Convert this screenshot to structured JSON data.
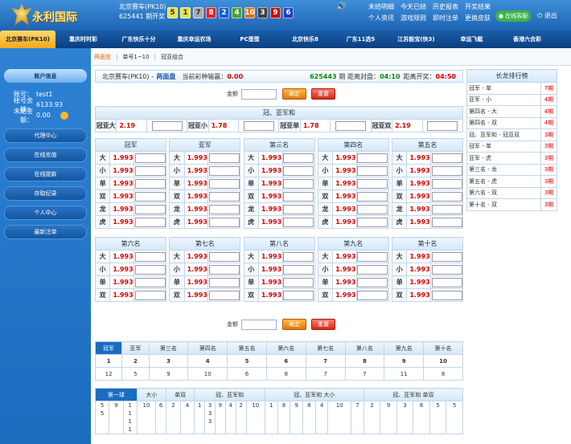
{
  "brand": {
    "name": "永利国际"
  },
  "lottery": {
    "name": "北京赛车(PK10)",
    "issue": "625441 期开奖",
    "balls": [
      {
        "n": "5",
        "c": "#e8e04a",
        "t": "#333"
      },
      {
        "n": "1",
        "c": "#e8e04a",
        "t": "#333"
      },
      {
        "n": "7",
        "c": "#aaaaaa",
        "t": "#333"
      },
      {
        "n": "8",
        "c": "#e0202a",
        "t": "#fff"
      },
      {
        "n": "2",
        "c": "#1060d0",
        "t": "#fff"
      },
      {
        "n": "4",
        "c": "#4aa030",
        "t": "#fff"
      },
      {
        "n": "10",
        "c": "#e07010",
        "t": "#fff"
      },
      {
        "n": "3",
        "c": "#404040",
        "t": "#fff"
      },
      {
        "n": "9",
        "c": "#c01010",
        "t": "#fff"
      },
      {
        "n": "6",
        "c": "#2040c0",
        "t": "#fff"
      }
    ]
  },
  "toplinks": [
    "未结明细",
    "今天已结",
    "历史报表",
    "开奖结果",
    "个人资讯",
    "游戏规则",
    "即时注单",
    "更换皮肤"
  ],
  "service": "在线客服",
  "logout": "退出",
  "nav": [
    "北京赛车(PK10)",
    "重庆时时彩",
    "广东快乐十分",
    "重庆幸运农场",
    "PC蛋蛋",
    "北京快乐8",
    "广东11选5",
    "江苏骰宝(快3)",
    "幸运飞艇",
    "香港六合彩"
  ],
  "side": {
    "title": "账户信息",
    "account_label": "账号：",
    "account": "test1",
    "balance_label": "帐号余额：",
    "balance": "6133.93",
    "unsettled_label": "未结金额：",
    "unsettled": "0.00",
    "menu": [
      "代理中心",
      "在线充值",
      "在线提款",
      "存取纪录",
      "个人中心",
      "最新注单"
    ]
  },
  "subnav": [
    "两面盘",
    "单号1~10",
    "冠亚组合"
  ],
  "info": {
    "game": "北京赛车(PK10)",
    "mode": "两面盘",
    "pl_label": "当前彩种输赢：",
    "pl": "0.00",
    "issue": "625443",
    "issue_suffix": "期 距离封盘：",
    "close": "04:10",
    "draw_label": "距离开奖：",
    "draw": "04:50"
  },
  "amount_label": "金额",
  "confirm": "确定",
  "reset": "重置",
  "gy": {
    "title": "冠、亚军和",
    "items": [
      {
        "l": "冠亚大",
        "o": "2.19"
      },
      {
        "l": "冠亚小",
        "o": "1.78"
      },
      {
        "l": "冠亚单",
        "o": "1.78"
      },
      {
        "l": "冠亚双",
        "o": "2.19"
      }
    ]
  },
  "odds": "1.993",
  "groups1": [
    {
      "t": "冠军",
      "rows": [
        "大",
        "小",
        "单",
        "双",
        "龙",
        "虎"
      ]
    },
    {
      "t": "亚军",
      "rows": [
        "大",
        "小",
        "单",
        "双",
        "龙",
        "虎"
      ]
    },
    {
      "t": "第三名",
      "rows": [
        "大",
        "小",
        "单",
        "双",
        "龙",
        "虎"
      ]
    },
    {
      "t": "第四名",
      "rows": [
        "大",
        "小",
        "单",
        "双",
        "龙",
        "虎"
      ]
    },
    {
      "t": "第五名",
      "rows": [
        "大",
        "小",
        "单",
        "双",
        "龙",
        "虎"
      ]
    }
  ],
  "groups2": [
    {
      "t": "第六名",
      "rows": [
        "大",
        "小",
        "单",
        "双"
      ]
    },
    {
      "t": "第七名",
      "rows": [
        "大",
        "小",
        "单",
        "双"
      ]
    },
    {
      "t": "第八名",
      "rows": [
        "大",
        "小",
        "单",
        "双"
      ]
    },
    {
      "t": "第九名",
      "rows": [
        "大",
        "小",
        "单",
        "双"
      ]
    },
    {
      "t": "第十名",
      "rows": [
        "大",
        "小",
        "单",
        "双"
      ]
    }
  ],
  "rank": {
    "title": "长龙排行榜",
    "rows": [
      [
        "冠军 - 单",
        "7期"
      ],
      [
        "亚军 - 小",
        "4期"
      ],
      [
        "第四名 - 大",
        "4期"
      ],
      [
        "第四名 - 双",
        "4期"
      ],
      [
        "冠、亚军和 - 冠亚双",
        "3期"
      ],
      [
        "冠军 - 单",
        "3期"
      ],
      [
        "亚军 - 虎",
        "3期"
      ],
      [
        "第三名 - 龙",
        "3期"
      ],
      [
        "第五名 - 虎",
        "3期"
      ],
      [
        "第六名 - 双",
        "3期"
      ],
      [
        "第十名 - 双",
        "3期"
      ]
    ]
  },
  "stats": {
    "tabs": [
      "冠军",
      "亚军",
      "第三名",
      "第四名",
      "第五名",
      "第六名",
      "第七名",
      "第八名",
      "第九名",
      "第十名"
    ],
    "nums": [
      "1",
      "2",
      "3",
      "4",
      "5",
      "6",
      "7",
      "8",
      "9",
      "10"
    ],
    "counts": [
      "12",
      "5",
      "9",
      "10",
      "6",
      "8",
      "7",
      "7",
      "11",
      "8"
    ]
  },
  "trend": {
    "tabs": [
      "第一球",
      "大小",
      "单双",
      "冠、亚军和",
      "冠、亚军和 大小",
      "冠、亚军和 单双"
    ],
    "cells": [
      "5\n5",
      "9",
      "1\n1\n1\n1",
      "10",
      "6",
      "2",
      "4",
      "1",
      "3\n3\n3",
      "9",
      "4",
      "2",
      "10",
      "1",
      "8",
      "9",
      "8",
      "4",
      "10",
      "7",
      "2",
      "9",
      "3",
      "8",
      "5",
      "5"
    ]
  }
}
